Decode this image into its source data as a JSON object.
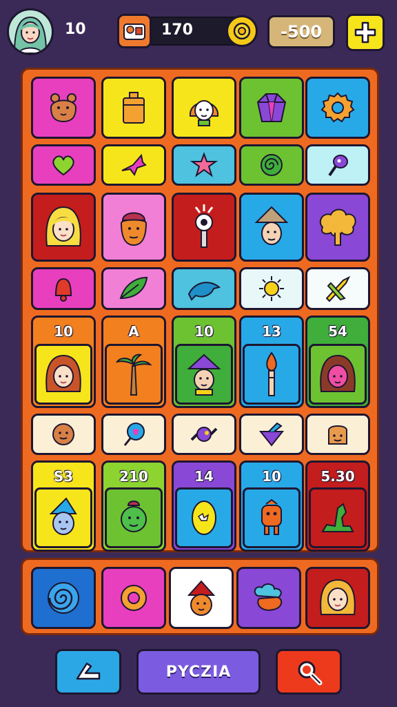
{
  "header": {
    "level": "10",
    "coins": "170",
    "score": "-500"
  },
  "board": {
    "header_values": [
      "10",
      "A",
      "10",
      "13",
      "54",
      "S3",
      "210",
      "14",
      "10",
      "5.30"
    ]
  },
  "footer": {
    "mid_label": "PYCZIA"
  },
  "colors": {
    "background": "#3b2a57",
    "board": "#ef6a21",
    "magenta": "#e83fbf",
    "yellow": "#f7e51b",
    "green": "#6dc232",
    "blue": "#27a9e8",
    "purple": "#8a48d6",
    "red": "#c41d1d",
    "pink": "#f27fd6",
    "orange": "#f3801f",
    "cream": "#fbf0d6"
  }
}
